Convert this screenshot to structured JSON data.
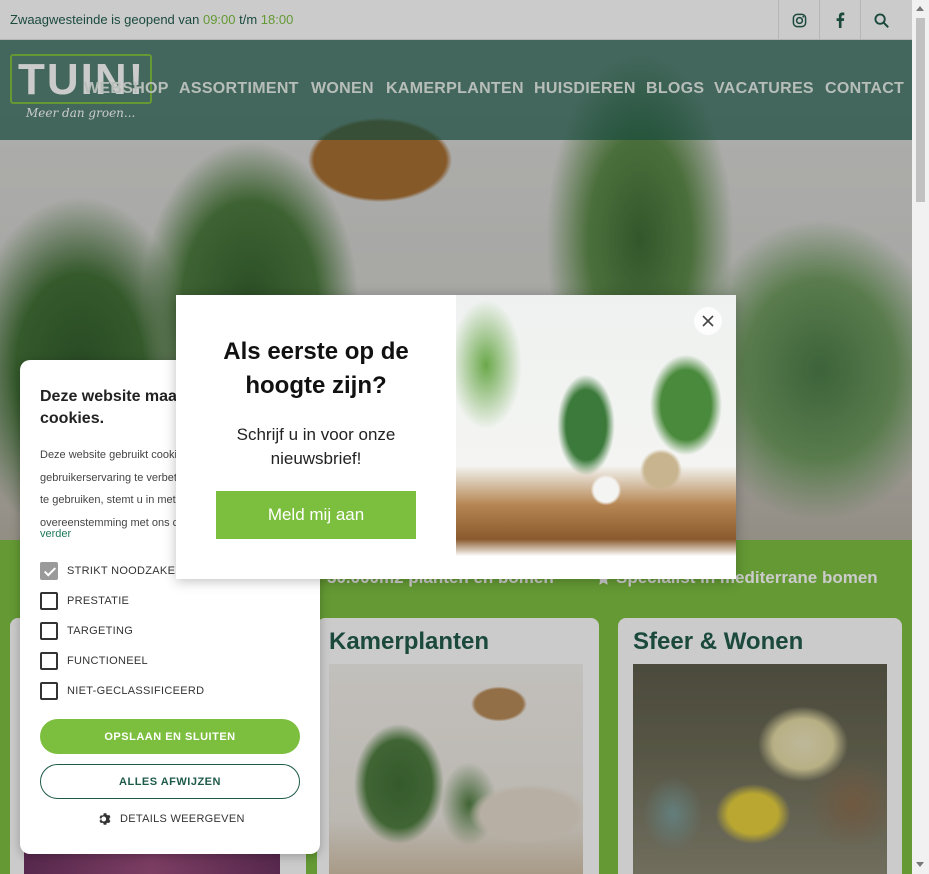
{
  "topbar": {
    "info_prefix": "Zwaagwesteinde is geopend van ",
    "open_time": "09:00",
    "info_mid": " t/m ",
    "close_time": "18:00",
    "icons": [
      "instagram-icon",
      "facebook-icon",
      "search-icon"
    ]
  },
  "logo": {
    "word": "TUIN!",
    "tagline": "Meer dan groen..."
  },
  "nav": [
    "WEBSHOP",
    "ASSORTIMENT",
    "WONEN",
    "KAMERPLANTEN",
    "HUISDIEREN",
    "BLOGS",
    "VACATURES",
    "CONTACT"
  ],
  "usps": [
    "30.000m2 planten en bomen",
    "Specialist in mediterrane bomen"
  ],
  "cards": [
    {
      "title": "Kamerplanten"
    },
    {
      "title": "Sfeer & Wonen"
    }
  ],
  "cookie": {
    "title": "Deze website maakt gebruik van cookies.",
    "body": "Deze website gebruikt cookies om de gebruikerservaring te verbeteren. Door onze website te gebruiken, stemt u in met alle cookies in overeenstemming met ons cookiebeleid.",
    "read_more": "verder",
    "options": [
      {
        "label": "STRIKT NOODZAKELIJK",
        "checked": true
      },
      {
        "label": "PRESTATIE",
        "checked": false
      },
      {
        "label": "TARGETING",
        "checked": false
      },
      {
        "label": "FUNCTIONEEL",
        "checked": false
      },
      {
        "label": "NIET-GECLASSIFICEERD",
        "checked": false
      }
    ],
    "save_label": "OPSLAAN EN SLUITEN",
    "reject_label": "ALLES AFWIJZEN",
    "details_label": "DETAILS WEERGEVEN"
  },
  "modal": {
    "heading": "Als eerste op de hoogte zijn?",
    "subtext": "Schrijf u in voor onze nieuwsbrief!",
    "cta_label": "Meld mij aan"
  },
  "colors": {
    "brand_green": "#7cbf3e",
    "dark_green": "#1e5a4a"
  }
}
